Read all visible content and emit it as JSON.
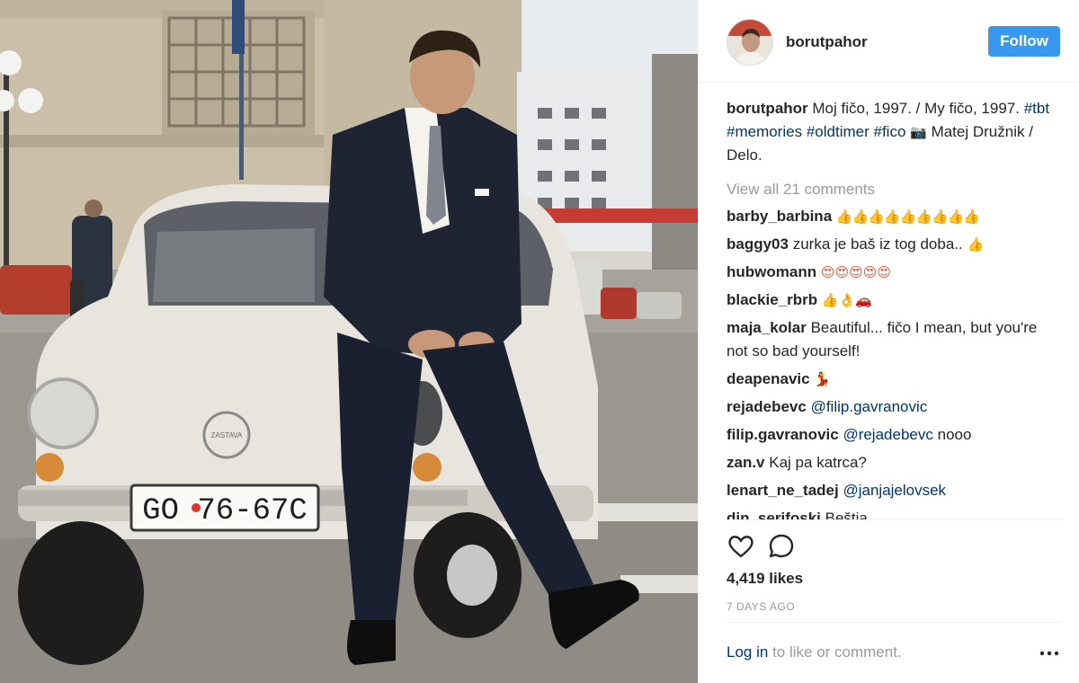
{
  "post": {
    "username": "borutpahor",
    "follow_label": "Follow",
    "caption": {
      "username": "borutpahor",
      "text": "Moj fičo, 1997. / My fičo, 1997.",
      "hashtags": [
        "#tbt",
        "#memories",
        "#oldtimer",
        "#fico"
      ],
      "camera_emoji": "📷",
      "credit": "Matej Družnik / Delo."
    },
    "view_all_comments": "View all 21 comments",
    "comments": [
      {
        "username": "barby_barbina",
        "text": "👍👍👍👍👍👍👍👍👍"
      },
      {
        "username": "baggy03",
        "text": "zurka je baš iz tog doba..",
        "emoji": "👍"
      },
      {
        "username": "hubwomann",
        "text": "😍😍😍😍😍"
      },
      {
        "username": "blackie_rbrb",
        "text": "👍👌🚗"
      },
      {
        "username": "maja_kolar",
        "text": "Beautiful... fičo I mean, but you're not so bad yourself!"
      },
      {
        "username": "deapenavic",
        "text": "💃"
      },
      {
        "username": "rejadebevc",
        "mention": "@filip.gavranovic"
      },
      {
        "username": "filip.gavranovic",
        "mention": "@rejadebevc",
        "text": "nooo"
      },
      {
        "username": "zan.v",
        "text": "Kaj pa katrca?"
      },
      {
        "username": "lenart_ne_tadej",
        "mention": "@janjajelovsek"
      },
      {
        "username": "din_serifoski",
        "text": "Beštja"
      }
    ],
    "likes": "4,419 likes",
    "time": "7 DAYS AGO",
    "login_link": "Log in",
    "login_rest": "to like or comment.",
    "icons": {
      "like": "heart-icon",
      "comment": "comment-icon",
      "more": "more-options-icon"
    },
    "photo": {
      "license_plate": "GO · 76-67C",
      "car_badge": "ZASTAVA"
    },
    "colors": {
      "accent": "#3897f0",
      "link": "#003569",
      "muted": "#999999",
      "text": "#262626"
    }
  }
}
